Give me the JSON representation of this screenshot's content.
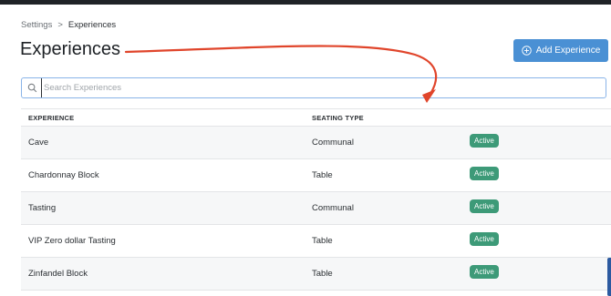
{
  "breadcrumb": {
    "root": "Settings",
    "separator": ">",
    "current": "Experiences"
  },
  "page": {
    "title": "Experiences"
  },
  "toolbar": {
    "add_label": "Add Experience"
  },
  "search": {
    "placeholder": "Search Experiences",
    "value": ""
  },
  "table": {
    "columns": {
      "experience": "EXPERIENCE",
      "seating": "SEATING TYPE",
      "status": ""
    },
    "rows": [
      {
        "experience": "Cave",
        "seating": "Communal",
        "status": "Active"
      },
      {
        "experience": "Chardonnay Block",
        "seating": "Table",
        "status": "Active"
      },
      {
        "experience": "Tasting",
        "seating": "Communal",
        "status": "Active"
      },
      {
        "experience": "VIP Zero dollar Tasting",
        "seating": "Table",
        "status": "Active"
      },
      {
        "experience": "Zinfandel Block",
        "seating": "Table",
        "status": "Active"
      }
    ]
  },
  "colors": {
    "accent": "#4a90d4",
    "badge": "#3d9a78",
    "arrow": "#e0452b"
  }
}
